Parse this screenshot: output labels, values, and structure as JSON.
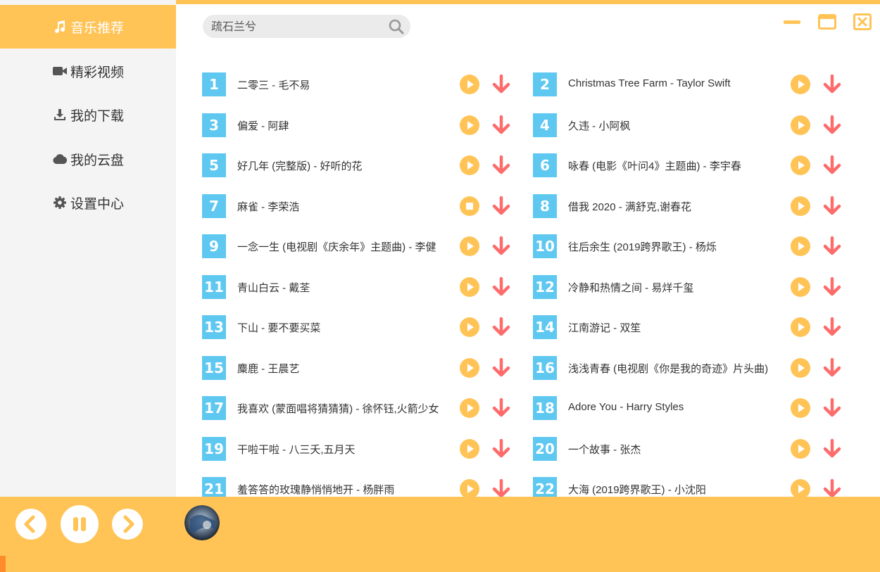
{
  "sidebar": {
    "items": [
      {
        "label": "音乐推荐",
        "icon": "music-note-icon",
        "active": true
      },
      {
        "label": "精彩视频",
        "icon": "video-camera-icon",
        "active": false
      },
      {
        "label": "我的下载",
        "icon": "download-icon",
        "active": false
      },
      {
        "label": "我的云盘",
        "icon": "cloud-icon",
        "active": false
      },
      {
        "label": "设置中心",
        "icon": "gear-icon",
        "active": false
      }
    ]
  },
  "search": {
    "placeholder": "疏石兰兮",
    "icon": "search-icon"
  },
  "window_controls": [
    "minimize-icon",
    "maximize-icon",
    "close-icon"
  ],
  "songs": [
    {
      "num": "1",
      "title": "二零三 - 毛不易",
      "playing": false
    },
    {
      "num": "2",
      "title": "Christmas Tree Farm - Taylor Swift",
      "playing": false
    },
    {
      "num": "3",
      "title": "偏爱 - 阿肆",
      "playing": false
    },
    {
      "num": "4",
      "title": "久违 - 小阿枫",
      "playing": false
    },
    {
      "num": "5",
      "title": "好几年 (完整版) - 好听的花",
      "playing": false
    },
    {
      "num": "6",
      "title": "咏春 (电影《叶问4》主题曲) - 李宇春",
      "playing": false
    },
    {
      "num": "7",
      "title": "麻雀 - 李荣浩",
      "playing": true
    },
    {
      "num": "8",
      "title": "借我 2020 - 满舒克,谢春花",
      "playing": false
    },
    {
      "num": "9",
      "title": "一念一生 (电视剧《庆余年》主题曲) - 李健",
      "playing": false
    },
    {
      "num": "10",
      "title": "往后余生 (2019跨界歌王) - 杨烁",
      "playing": false
    },
    {
      "num": "11",
      "title": "青山白云 - 戴荃",
      "playing": false
    },
    {
      "num": "12",
      "title": "冷静和热情之间 - 易烊千玺",
      "playing": false
    },
    {
      "num": "13",
      "title": "下山 - 要不要买菜",
      "playing": false
    },
    {
      "num": "14",
      "title": "江南游记 - 双笙",
      "playing": false
    },
    {
      "num": "15",
      "title": "麋鹿 - 王晨艺",
      "playing": false
    },
    {
      "num": "16",
      "title": "浅浅青春 (电视剧《你是我的奇迹》片头曲)",
      "playing": false
    },
    {
      "num": "17",
      "title": "我喜欢 (蒙面唱将猜猜猜) - 徐怀钰,火箭少女",
      "playing": false
    },
    {
      "num": "18",
      "title": "Adore You - Harry Styles",
      "playing": false
    },
    {
      "num": "19",
      "title": "干啦干啦 - 八三夭,五月天",
      "playing": false
    },
    {
      "num": "20",
      "title": "一个故事 - 张杰",
      "playing": false
    },
    {
      "num": "21",
      "title": "羞答答的玫瑰静悄悄地开 - 杨胖雨",
      "playing": false
    },
    {
      "num": "22",
      "title": "大海 (2019跨界歌王) - 小沈阳",
      "playing": false
    }
  ],
  "player": {
    "controls": [
      "previous-icon",
      "pause-icon",
      "next-icon"
    ],
    "progress_fraction": 0.006
  },
  "colors": {
    "accent": "#ffc356",
    "number_badge": "#5ec8f1",
    "download_arrow": "#fd6b6b",
    "progress": "#ff8c2a"
  }
}
